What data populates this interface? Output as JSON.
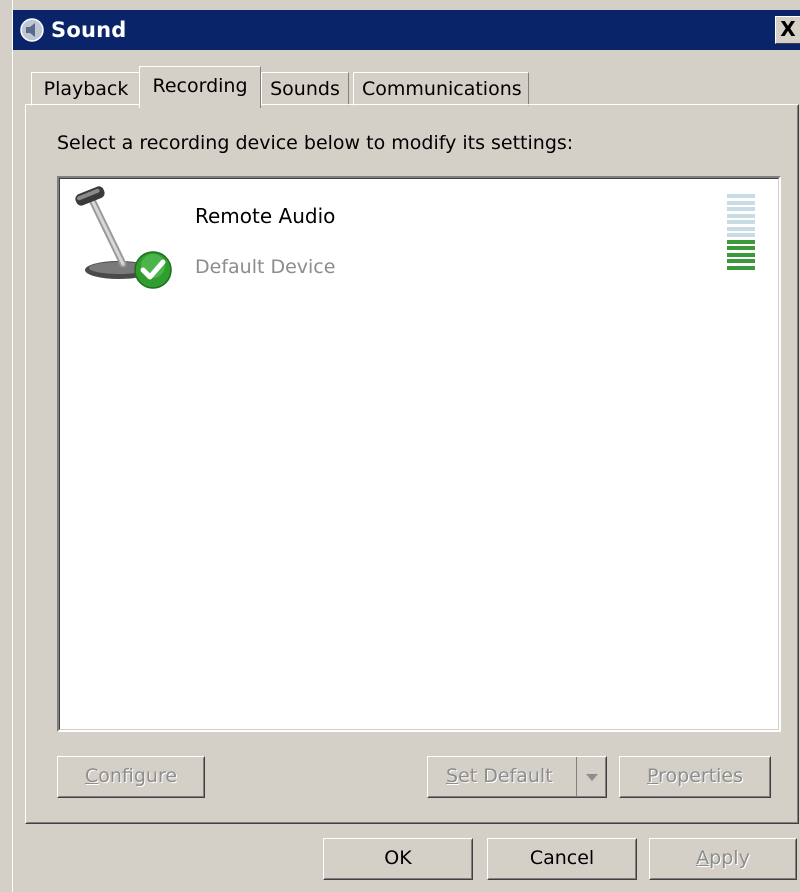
{
  "window": {
    "title": "Sound",
    "close_label": "X"
  },
  "tabs": [
    {
      "label": "Playback",
      "active": false
    },
    {
      "label": "Recording",
      "active": true
    },
    {
      "label": "Sounds",
      "active": false
    },
    {
      "label": "Communications",
      "active": false
    }
  ],
  "recording": {
    "instructions": "Select a recording device below to modify its settings:",
    "devices": [
      {
        "name": "Remote Audio",
        "status": "Default Device",
        "icon": "microphone-icon",
        "default_badge": "green-check-icon",
        "level_segments_total": 12,
        "level_segments_active": 5
      }
    ]
  },
  "panel_buttons": {
    "configure": {
      "prefix": "",
      "mnemonic": "C",
      "rest": "onfigure"
    },
    "set_default": {
      "prefix": "",
      "mnemonic": "S",
      "rest": "et Default"
    },
    "properties": {
      "prefix": "",
      "mnemonic": "P",
      "rest": "roperties"
    }
  },
  "dialog_buttons": {
    "ok": "OK",
    "cancel": "Cancel",
    "apply": {
      "prefix": "",
      "mnemonic": "A",
      "rest": "pply"
    }
  },
  "colors": {
    "titlebar": "#0a246a",
    "meter_active": "#3a9a3a",
    "meter_inactive": "#c8dce6",
    "check_badge": "#2f9e2f"
  }
}
